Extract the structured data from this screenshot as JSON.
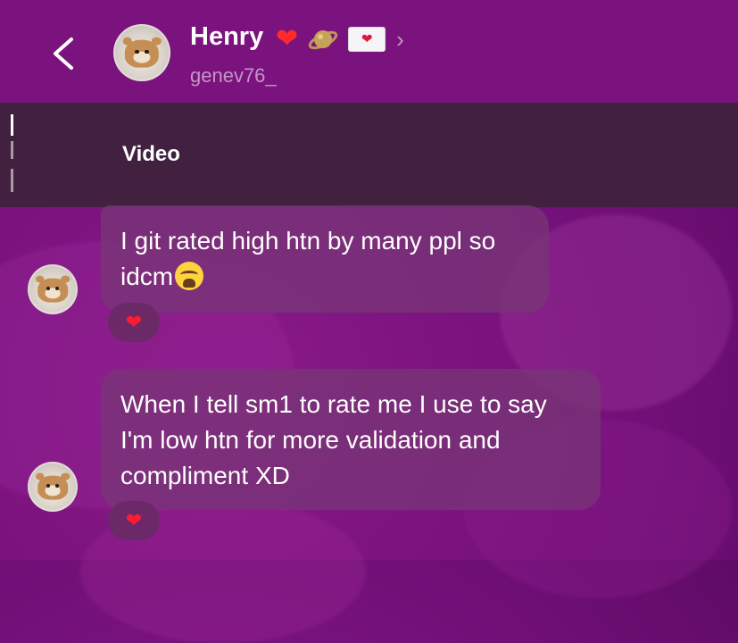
{
  "header": {
    "back_icon": "chevron-left-icon",
    "avatar_icon": "bear-avatar-icon",
    "name": "Henry",
    "name_badges": [
      "red-heart-icon",
      "planet-icon",
      "love-letter-icon"
    ],
    "chevron_icon": "chevron-right-icon",
    "username": "genev76_"
  },
  "reply_preview": {
    "label": "Video"
  },
  "messages": [
    {
      "text_line1": "I git rated high htn by many ppl so",
      "text_line2": "idcm",
      "emoji": "crying-face-icon",
      "reaction": "heart-icon"
    },
    {
      "text_line1": "When I tell sm1 to rate me I use to say",
      "text_line2": "I'm low htn for more validation and",
      "text_line3": "compliment XD",
      "reaction": "heart-icon"
    }
  ],
  "colors": {
    "header_bg": "#7b137e",
    "strip_bg": "#41213f",
    "bubble_bg": "#783476",
    "heart": "#ff1c33"
  }
}
